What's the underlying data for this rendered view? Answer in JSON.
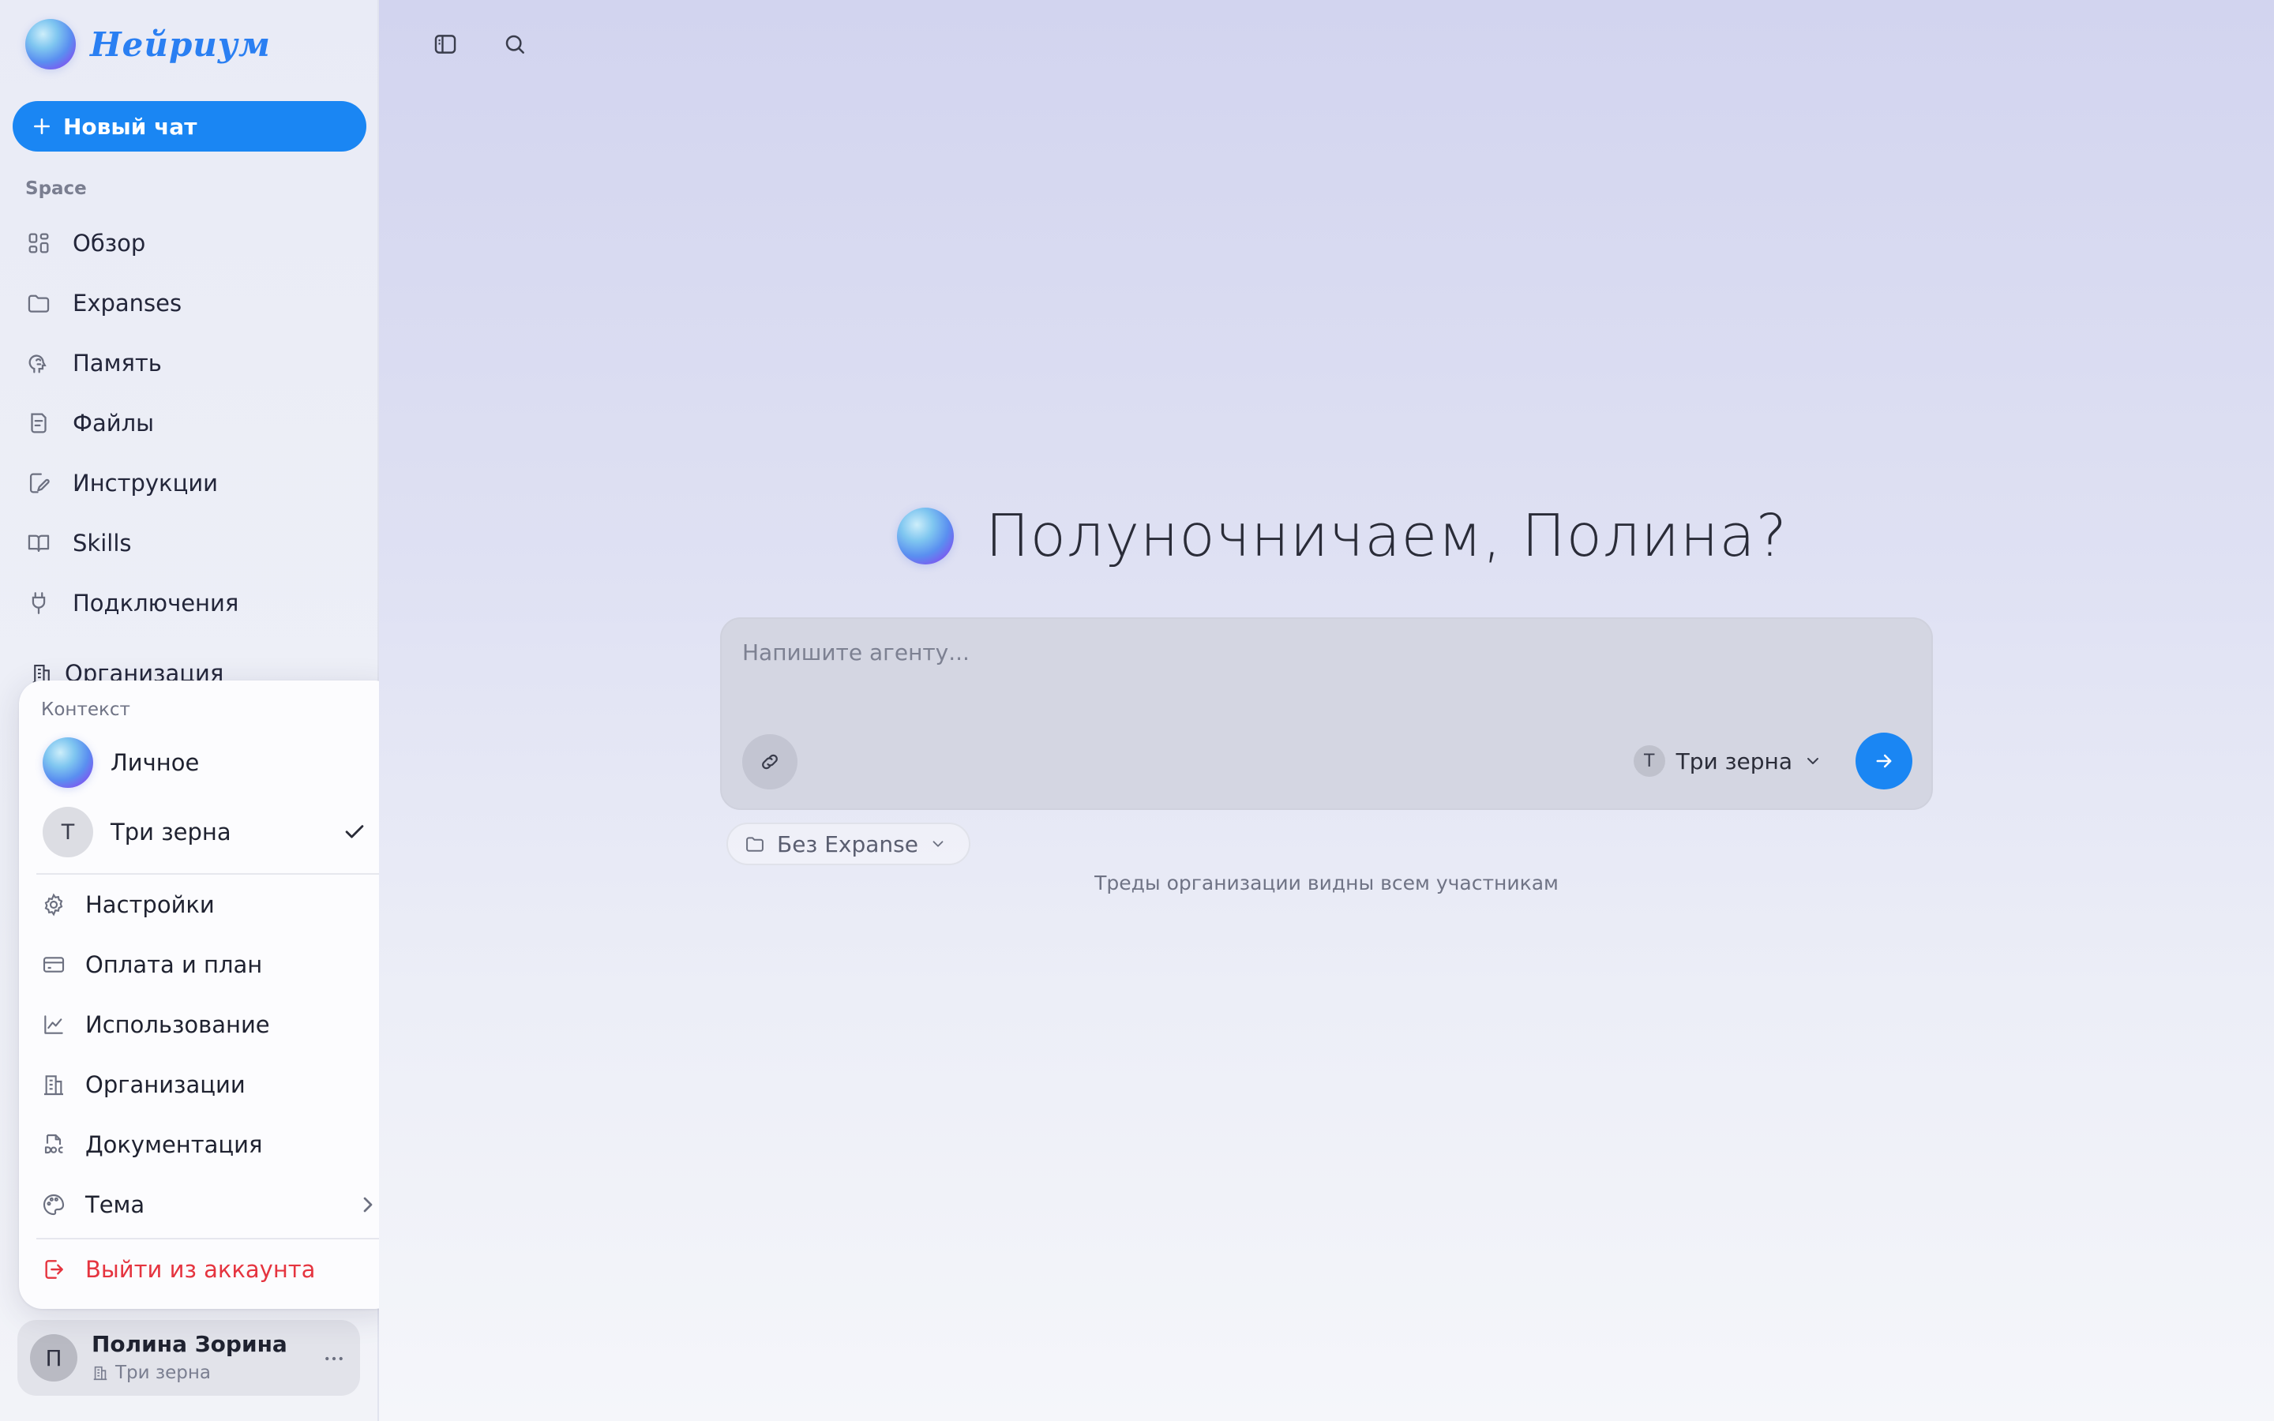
{
  "brand": {
    "name": "Нейриум"
  },
  "sidebar": {
    "new_chat_label": "Новый чат",
    "section_label": "Space",
    "items": [
      {
        "label": "Обзор",
        "icon": "grid-icon"
      },
      {
        "label": "Expanses",
        "icon": "folder-icon"
      },
      {
        "label": "Память",
        "icon": "brain-icon"
      },
      {
        "label": "Файлы",
        "icon": "file-icon"
      },
      {
        "label": "Инструкции",
        "icon": "edit-file-icon"
      },
      {
        "label": "Skills",
        "icon": "book-icon"
      },
      {
        "label": "Подключения",
        "icon": "plug-icon"
      }
    ],
    "org_label": "Организация"
  },
  "account_menu": {
    "context_label": "Контекст",
    "contexts": [
      {
        "label": "Личное",
        "avatar": "orb",
        "selected": false
      },
      {
        "label": "Три зерна",
        "avatar_letter": "Т",
        "selected": true
      }
    ],
    "items": [
      {
        "label": "Настройки",
        "icon": "gear-icon"
      },
      {
        "label": "Оплата и план",
        "icon": "credit-card-icon"
      },
      {
        "label": "Использование",
        "icon": "chart-line-icon"
      },
      {
        "label": "Организации",
        "icon": "building-icon"
      },
      {
        "label": "Документация",
        "icon": "doc-icon"
      },
      {
        "label": "Тема",
        "icon": "palette-icon"
      }
    ],
    "logout_label": "Выйти из аккаунта"
  },
  "user": {
    "avatar_letter": "П",
    "name": "Полина Зорина",
    "org": "Три зерна"
  },
  "main": {
    "greeting": "Полуночничаем, Полина?",
    "composer": {
      "placeholder": "Напишите агенту...",
      "context_letter": "Т",
      "context_label": "Три зерна"
    },
    "expanse_label": "Без Expanse",
    "hint": "Треды организации видны всем участникам"
  },
  "colors": {
    "accent": "#1a86f3",
    "danger": "#e5343f",
    "brand_text": "#2a7ff2"
  }
}
